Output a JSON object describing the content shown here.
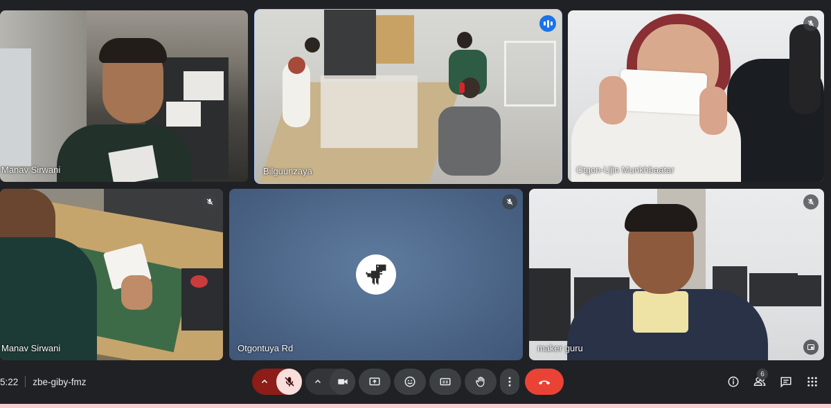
{
  "tiles": [
    {
      "id": "t1",
      "name": "Manav Sirwani",
      "mic": "unmuted"
    },
    {
      "id": "t2",
      "name": "Bilguunzaya",
      "mic": "speaking"
    },
    {
      "id": "t3",
      "name": "Otgon-Ujin Munkhbaatar",
      "mic": "muted"
    },
    {
      "id": "t4",
      "name": "Manav Sirwani",
      "mic": "muted"
    },
    {
      "id": "t5",
      "name": "Otgontuya Rd",
      "mic": "muted",
      "avatar_icon": "dinosaur-icon"
    },
    {
      "id": "t6",
      "name": "maker guru",
      "mic": "muted"
    }
  ],
  "meeting": {
    "time": "5:22",
    "code": "zbe-giby-fmz"
  },
  "people_count": "6",
  "colors": {
    "background": "#202124",
    "control": "#3c4043",
    "mic_off_bg": "#f9dedc",
    "end_call": "#ea4335",
    "speaking": "#1a73e8",
    "active_outline": "#a8c7fa"
  },
  "icons": {
    "controls": [
      "chevron-up-icon",
      "mic-off-icon",
      "chevron-up-icon",
      "camera-icon",
      "present-screen-icon",
      "emoji-icon",
      "captions-icon",
      "raise-hand-icon",
      "more-options-icon",
      "end-call-icon"
    ],
    "right": [
      "info-icon",
      "people-icon",
      "chat-icon",
      "activities-icon"
    ]
  }
}
